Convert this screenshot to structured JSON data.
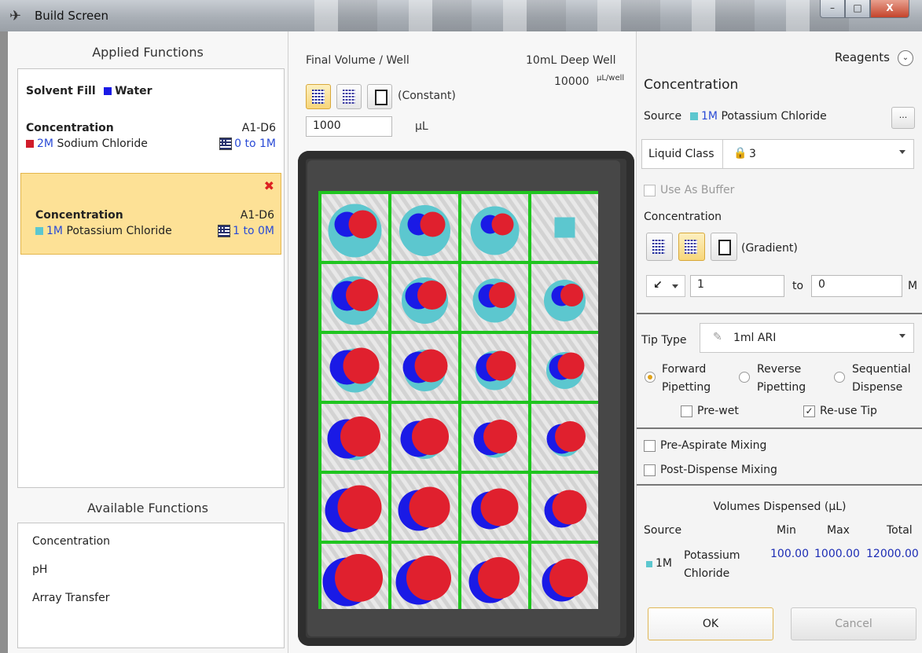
{
  "window": {
    "title": "Build Screen",
    "controls": {
      "minimize": "–",
      "maximize": "□",
      "close": "X"
    }
  },
  "left": {
    "applied_title": "Applied Functions",
    "solvent": {
      "name": "Solvent Fill",
      "reagent": "Water",
      "color": "#1a1ae6"
    },
    "functions": [
      {
        "name": "Concentration",
        "range": "A1-D6",
        "molar": "2M",
        "reagent": "Sodium Chloride",
        "gradient": "0 to 1M",
        "color": "#d01c2a",
        "selected": false
      },
      {
        "name": "Concentration",
        "range": "A1-D6",
        "molar": "1M",
        "reagent": "Potassium Chloride",
        "gradient": "1 to 0M",
        "color": "#5cc7cf",
        "selected": true
      }
    ],
    "available_title": "Available Functions",
    "available": [
      "Concentration",
      "pH",
      "Array Transfer"
    ]
  },
  "middle": {
    "final_volume_label": "Final Volume / Well",
    "plate_name": "10mL Deep Well",
    "plate_capacity": "10000",
    "capacity_unit": "µL/well",
    "mode_label": "(Constant)",
    "volume_value": "1000",
    "volume_unit": "µL"
  },
  "right": {
    "reagents_label": "Reagents",
    "section_title": "Concentration",
    "source_label": "Source",
    "source_molar": "1M",
    "source_name": "Potassium Chloride",
    "source_color": "#5cc7cf",
    "ellipsis": "...",
    "liquid_class_label": "Liquid Class",
    "liquid_class_value": "3",
    "use_as_buffer": "Use As Buffer",
    "concentration_label": "Concentration",
    "gradient_mode": "(Gradient)",
    "from_value": "1",
    "to_label": "to",
    "to_value": "0",
    "unit": "M",
    "tip_type_label": "Tip Type",
    "tip_type_value": "1ml ARI",
    "pipetting": [
      {
        "line1": "Forward",
        "line2": "Pipetting",
        "selected": true
      },
      {
        "line1": "Reverse",
        "line2": "Pipetting",
        "selected": false
      },
      {
        "line1": "Sequential",
        "line2": "Dispense",
        "selected": false
      }
    ],
    "pre_wet": "Pre-wet",
    "reuse_tip": "Re-use Tip",
    "pre_aspirate": "Pre-Aspirate Mixing",
    "post_dispense": "Post-Dispense Mixing",
    "volumes_title": "Volumes Dispensed (µL)",
    "cols": {
      "source": "Source",
      "min": "Min",
      "max": "Max",
      "total": "Total"
    },
    "row": {
      "molar": "1M",
      "name1": "Potassium",
      "name2": "Chloride",
      "min": "100.00",
      "max": "1000.00",
      "total": "12000.00"
    },
    "ok": "OK",
    "cancel": "Cancel"
  }
}
